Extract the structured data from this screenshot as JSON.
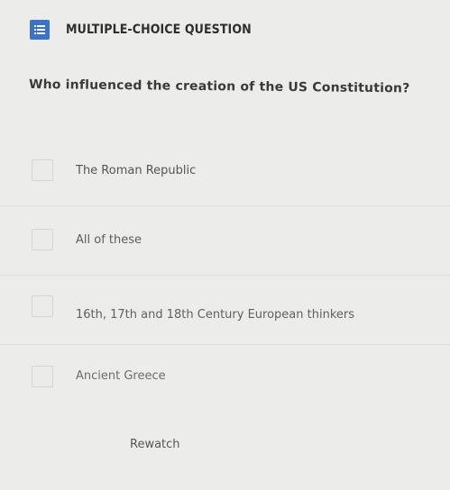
{
  "header": {
    "type_label": "MULTIPLE-CHOICE QUESTION",
    "icon": "list-icon",
    "icon_color": "#3b73c8"
  },
  "question": {
    "text": "Who influenced the creation of the US Constitution?"
  },
  "options": [
    {
      "label": "The Roman Republic",
      "checked": false
    },
    {
      "label": "All of these",
      "checked": false
    },
    {
      "label": "16th, 17th and 18th Century European thinkers",
      "checked": false
    },
    {
      "label": "Ancient Greece",
      "checked": false
    }
  ],
  "rewatch_label": "Rewatch"
}
